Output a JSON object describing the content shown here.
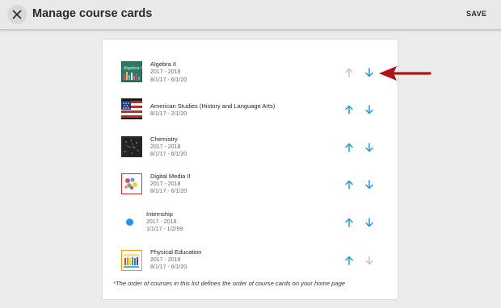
{
  "header": {
    "title": "Manage course cards",
    "save_label": "SAVE",
    "close_icon": "close-icon"
  },
  "colors": {
    "accent": "#2196f3",
    "disabled_arrow": "#c4c4c4",
    "callout_arrow": "#b31217"
  },
  "courses": [
    {
      "name": "Algebra II",
      "term": "2017 - 2018",
      "dates": "8/1/17 - 6/1/20",
      "thumbnail": "algebra-thumbnail",
      "up_enabled": false,
      "down_enabled": true
    },
    {
      "name": "American Studies (History and Language Arts)",
      "term": "",
      "dates": "8/1/17 - 2/1/20",
      "thumbnail": "flag-thumbnail",
      "up_enabled": true,
      "down_enabled": true
    },
    {
      "name": "Chemistry",
      "term": "2017 - 2018",
      "dates": "8/1/17 - 6/1/20",
      "thumbnail": "chalkboard-thumbnail",
      "up_enabled": true,
      "down_enabled": true
    },
    {
      "name": "Digital Media II",
      "term": "2017 - 2018",
      "dates": "8/1/17 - 6/1/20",
      "thumbnail": "media-thumbnail",
      "up_enabled": true,
      "down_enabled": true
    },
    {
      "name": "Internship",
      "term": "2017 - 2018",
      "dates": "1/1/17 - 1/2/99",
      "thumbnail": "blue-dot",
      "up_enabled": true,
      "down_enabled": true
    },
    {
      "name": "Physical Education",
      "term": "2017 - 2018",
      "dates": "8/1/17 - 6/1/20",
      "thumbnail": "pe-thumbnail",
      "up_enabled": true,
      "down_enabled": false
    }
  ],
  "footnote": "*The order of courses in this list defines the order of course cards on your home page",
  "annotation": {
    "callout_icon": "red-arrow-icon"
  }
}
